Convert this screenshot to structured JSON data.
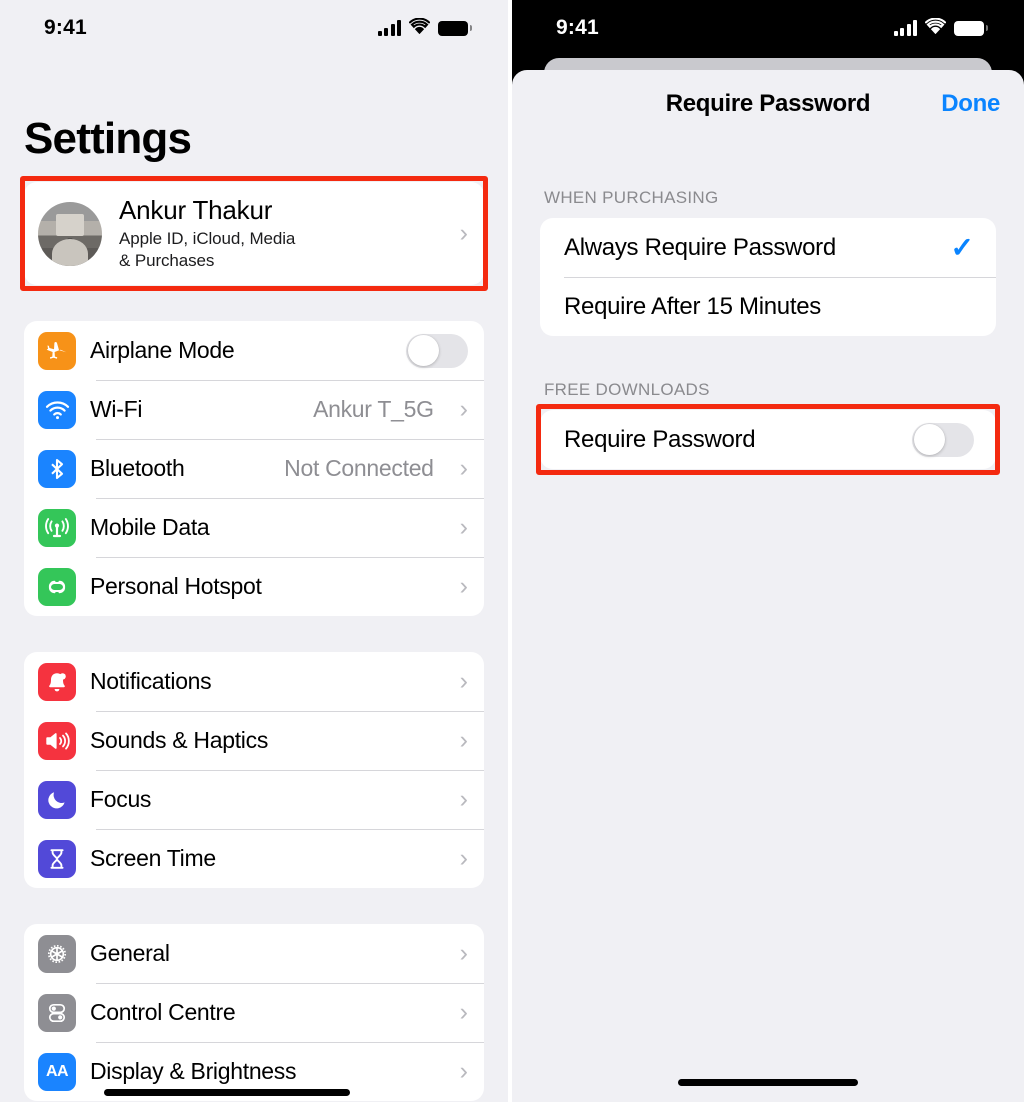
{
  "left": {
    "status_bar": {
      "time": "9:41",
      "signal_icon": "cellular-signal-icon",
      "wifi_icon": "wifi-icon",
      "battery_icon": "battery-full-icon"
    },
    "page_title": "Settings",
    "apple_id": {
      "name": "Ankur Thakur",
      "subtitle": "Apple ID, iCloud, Media\n& Purchases",
      "subtitle_line1": "Apple ID, iCloud, Media",
      "subtitle_line2": "& Purchases",
      "avatar_icon": "user-avatar",
      "chevron": "›",
      "highlighted": true
    },
    "groups": [
      {
        "rows": [
          {
            "label": "Airplane Mode",
            "icon": "airplane-icon",
            "icon_color": "#f79218",
            "control": "toggle",
            "toggle_on": false
          },
          {
            "label": "Wi-Fi",
            "icon": "wifi-icon",
            "icon_color": "#1a84ff",
            "value": "Ankur T_5G",
            "control": "chevron"
          },
          {
            "label": "Bluetooth",
            "icon": "bluetooth-icon",
            "icon_color": "#1a84ff",
            "value": "Not Connected",
            "control": "chevron"
          },
          {
            "label": "Mobile Data",
            "icon": "cellular-antenna-icon",
            "icon_color": "#34c659",
            "value": "",
            "control": "chevron"
          },
          {
            "label": "Personal Hotspot",
            "icon": "hotspot-link-icon",
            "icon_color": "#34c659",
            "value": "",
            "control": "chevron"
          }
        ]
      },
      {
        "rows": [
          {
            "label": "Notifications",
            "icon": "bell-icon",
            "icon_color": "#f5333f",
            "value": "",
            "control": "chevron"
          },
          {
            "label": "Sounds & Haptics",
            "icon": "speaker-icon",
            "icon_color": "#f5333f",
            "value": "",
            "control": "chevron"
          },
          {
            "label": "Focus",
            "icon": "moon-icon",
            "icon_color": "#5249d8",
            "value": "",
            "control": "chevron"
          },
          {
            "label": "Screen Time",
            "icon": "hourglass-icon",
            "icon_color": "#5249d8",
            "value": "",
            "control": "chevron"
          }
        ]
      },
      {
        "rows": [
          {
            "label": "General",
            "icon": "gear-icon",
            "icon_color": "#8e8e93",
            "value": "",
            "control": "chevron"
          },
          {
            "label": "Control Centre",
            "icon": "sliders-icon",
            "icon_color": "#8e8e93",
            "value": "",
            "control": "chevron"
          },
          {
            "label": "Display & Brightness",
            "icon": "text-size-aa-icon",
            "icon_color": "#1a84ff",
            "value": "",
            "control": "chevron"
          }
        ]
      }
    ]
  },
  "right": {
    "status_bar": {
      "time": "9:41",
      "signal_icon": "cellular-signal-icon",
      "wifi_icon": "wifi-icon",
      "battery_icon": "battery-full-icon"
    },
    "sheet_title": "Require Password",
    "done_label": "Done",
    "sections": [
      {
        "header": "WHEN PURCHASING",
        "rows": [
          {
            "label": "Always Require Password",
            "control": "check",
            "checked": true
          },
          {
            "label": "Require After 15 Minutes",
            "control": "none",
            "checked": false
          }
        ]
      },
      {
        "header": "FREE DOWNLOADS",
        "highlighted": true,
        "rows": [
          {
            "label": "Require Password",
            "control": "toggle",
            "toggle_on": false
          }
        ]
      }
    ]
  },
  "colors": {
    "accent_blue": "#0a84ff",
    "highlight_red": "#f42a10",
    "screen_background": "#f0f0f4",
    "card_white": "#ffffff",
    "secondary_text": "#8e8e93"
  }
}
